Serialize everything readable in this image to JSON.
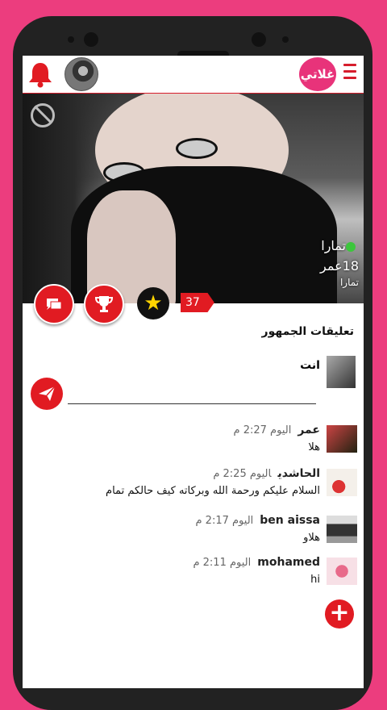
{
  "header": {
    "logo_text": "غلاتي",
    "menu_icon": "hamburger-icon",
    "bell_icon": "bell-icon"
  },
  "profile": {
    "name": "تمارا",
    "age": "18عمر",
    "username": "تمارا",
    "online_color": "#3cc63c",
    "count": "37"
  },
  "comments_section": {
    "title": "تعليقات الجمهور",
    "me_label": "انت"
  },
  "comments": [
    {
      "name": "عمر",
      "time": "اليوم 2:27 م",
      "text": "هلا"
    },
    {
      "name": "الحاشدي",
      "time": "اليوم 2:25 م",
      "text": "السلام عليكم ورحمة الله وبركاته كيف حالكم تمام"
    },
    {
      "name": "ben aissa",
      "time": "اليوم 2:17 م",
      "text": "هلاو"
    },
    {
      "name": "mohamed",
      "time": "اليوم 2:11 م",
      "text": "hi"
    }
  ],
  "colors": {
    "accent": "#e11b22",
    "background": "#ec3d7e"
  }
}
